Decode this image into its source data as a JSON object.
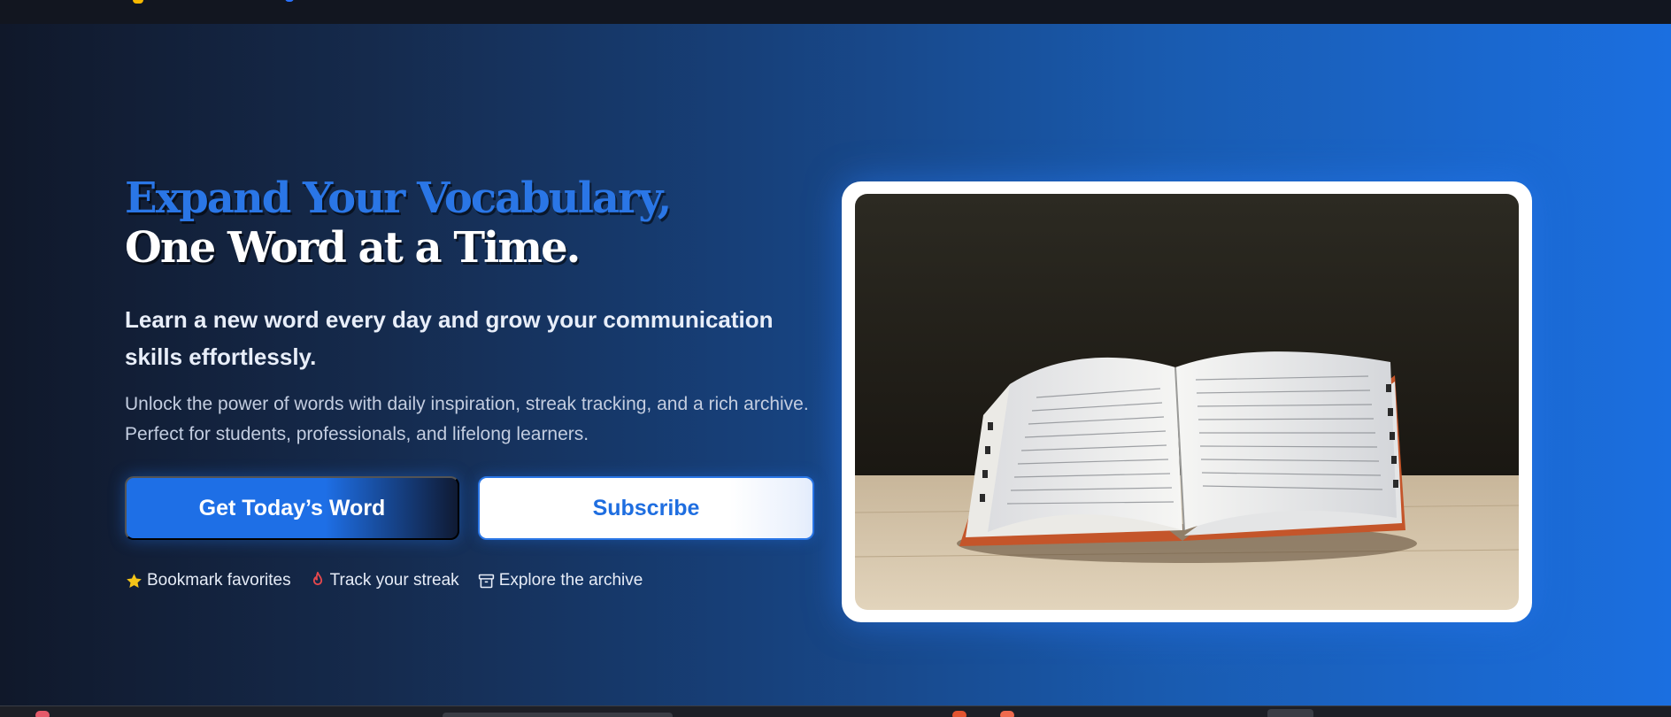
{
  "hero": {
    "title_line1": "Expand Your Vocabulary,",
    "title_line2": "One Word at a Time.",
    "subtitle": "Learn a new word every day and grow your communication skills effortlessly.",
    "description": "Unlock the power of words with daily inspiration, streak tracking, and a rich archive. Perfect for students, professionals, and lifelong learners."
  },
  "buttons": {
    "primary_label": "Get Today’s Word",
    "secondary_label": "Subscribe"
  },
  "features": [
    {
      "icon": "star-icon",
      "label": "Bookmark favorites"
    },
    {
      "icon": "flame-icon",
      "label": "Track your streak"
    },
    {
      "icon": "archive-box-icon",
      "label": "Explore the archive"
    }
  ],
  "image": {
    "subject": "open-dictionary-photo"
  },
  "colors": {
    "accent": "#1e6fe6",
    "title_accent": "#2a76e6",
    "star": "#f5c518",
    "flame": "#e5484d"
  }
}
